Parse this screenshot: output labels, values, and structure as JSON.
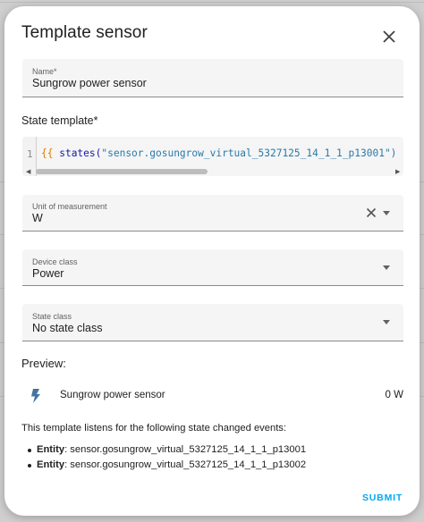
{
  "dialog": {
    "title": "Template sensor",
    "close_icon": "close-icon"
  },
  "name_field": {
    "label": "Name*",
    "value": "Sungrow power sensor"
  },
  "state_template": {
    "label": "State template*",
    "line_number": "1",
    "code_open": "{{",
    "code_fn": " states(",
    "code_str": "\"sensor.gosungrow_virtual_5327125_14_1_1_p13001\")"
  },
  "unit_field": {
    "label": "Unit of measurement",
    "value": "W"
  },
  "device_class_field": {
    "label": "Device class",
    "value": "Power"
  },
  "state_class_field": {
    "label": "State class",
    "value": "No state class"
  },
  "preview": {
    "heading": "Preview:",
    "icon": "flash-icon",
    "entity_name": "Sungrow power sensor",
    "state": "0 W"
  },
  "listen": {
    "text": "This template listens for the following state changed events:",
    "entities": [
      {
        "prefix": "Entity",
        "value": ": sensor.gosungrow_virtual_5327125_14_1_1_p13001"
      },
      {
        "prefix": "Entity",
        "value": ": sensor.gosungrow_virtual_5327125_14_1_1_p13002"
      }
    ]
  },
  "actions": {
    "submit_label": "SUBMIT"
  },
  "colors": {
    "accent": "#03a9f4",
    "icon": "#44739e"
  }
}
